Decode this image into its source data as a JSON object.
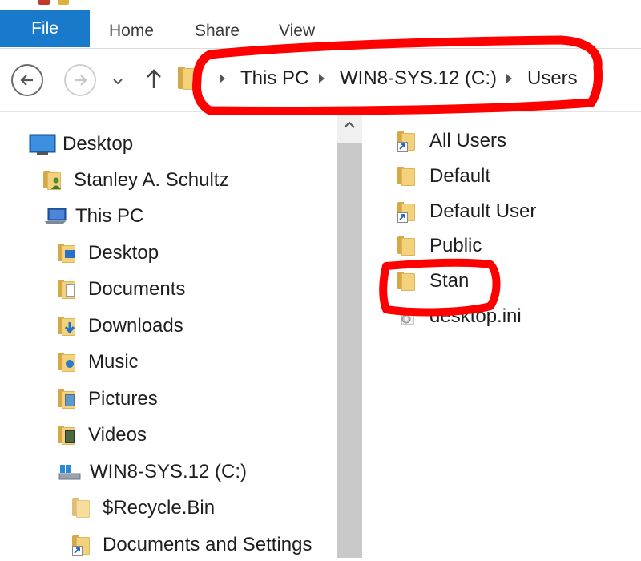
{
  "ribbon": {
    "file_tab": "File",
    "tabs": [
      "Home",
      "Share",
      "View"
    ]
  },
  "address_bar": {
    "breadcrumbs": [
      "This PC",
      "WIN8-SYS.12 (C:)",
      "Users"
    ]
  },
  "nav_pane": {
    "items": [
      {
        "label": "Desktop",
        "icon": "desktop-icon"
      },
      {
        "label": "Stanley A. Schultz",
        "icon": "user-folder-icon"
      },
      {
        "label": "This PC",
        "icon": "this-pc-icon"
      },
      {
        "label": "Desktop",
        "icon": "desktop-folder-icon"
      },
      {
        "label": "Documents",
        "icon": "documents-folder-icon"
      },
      {
        "label": "Downloads",
        "icon": "downloads-folder-icon"
      },
      {
        "label": "Music",
        "icon": "music-folder-icon"
      },
      {
        "label": "Pictures",
        "icon": "pictures-folder-icon"
      },
      {
        "label": "Videos",
        "icon": "videos-folder-icon"
      },
      {
        "label": "WIN8-SYS.12 (C:)",
        "icon": "drive-icon"
      },
      {
        "label": "$Recycle.Bin",
        "icon": "folder-icon"
      },
      {
        "label": "Documents and Settings",
        "icon": "shortcut-folder-icon"
      }
    ]
  },
  "file_list": {
    "items": [
      {
        "label": "All Users",
        "icon": "shortcut-folder-icon"
      },
      {
        "label": "Default",
        "icon": "folder-icon"
      },
      {
        "label": "Default User",
        "icon": "shortcut-folder-icon"
      },
      {
        "label": "Public",
        "icon": "folder-icon"
      },
      {
        "label": "Stan",
        "icon": "folder-icon"
      },
      {
        "label": "desktop.ini",
        "icon": "settings-file-icon"
      }
    ]
  },
  "colors": {
    "file_tab": "#1979ca",
    "annotation": "#ff0000",
    "folder": "#f4d27c"
  }
}
